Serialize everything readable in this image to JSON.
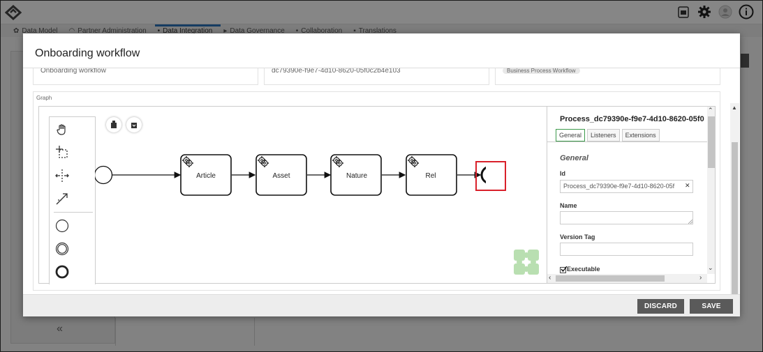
{
  "app": {
    "nav_tabs": [
      {
        "label": "Data Model",
        "active": false
      },
      {
        "label": "Partner Administration",
        "active": false
      },
      {
        "label": "Data Integration",
        "active": true
      },
      {
        "label": "Data Governance",
        "active": false
      },
      {
        "label": "Collaboration",
        "active": false
      },
      {
        "label": "Translations",
        "active": false
      }
    ],
    "collapse_glyph": "«"
  },
  "modal": {
    "title": "Onboarding workflow",
    "summary": {
      "name_value": "Onboarding workflow",
      "id_value": "dc79390e-f9e7-4d10-8620-05f0c2b4e103",
      "type_chip": "Business Process Workflow"
    },
    "graph_label": "Graph",
    "diagram": {
      "tasks": [
        "Article",
        "Asset",
        "Nature",
        "Rel"
      ],
      "highlight_color": "#d9202a"
    },
    "properties": {
      "title": "Process_dc79390e-f9e7-4d10-8620-05f0",
      "tabs": [
        {
          "label": "General",
          "active": true
        },
        {
          "label": "Listeners",
          "active": false
        },
        {
          "label": "Extensions",
          "active": false
        }
      ],
      "section_title": "General",
      "id_label": "Id",
      "id_value": "Process_dc79390e-f9e7-4d10-8620-05f",
      "name_label": "Name",
      "name_value": "",
      "version_tag_label": "Version Tag",
      "version_tag_value": "",
      "executable_label": "Executable",
      "executable_checked": true
    },
    "footer": {
      "discard_label": "DISCARD",
      "save_label": "SAVE"
    }
  },
  "colors": {
    "accent_green": "#3c9a4b",
    "button_dark": "#5a5a5a",
    "highlight_red": "#d9202a"
  }
}
